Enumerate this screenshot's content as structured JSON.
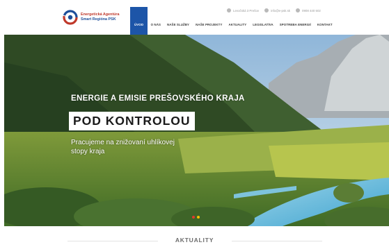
{
  "header": {
    "logo": {
      "line1": "Energetická Agentúra",
      "line2": "Smart Regióna PSK"
    },
    "topbar": [
      {
        "icon": "map-pin-icon",
        "text": "Levočská 3 Prešov"
      },
      {
        "icon": "mail-icon",
        "text": "info@e-psk.sk"
      },
      {
        "icon": "phone-icon",
        "text": "0908 440 502"
      }
    ],
    "nav": [
      {
        "label": "ÚVOD",
        "active": true
      },
      {
        "label": "O NÁS",
        "active": false
      },
      {
        "label": "NAŠE SLUŽBY",
        "active": false
      },
      {
        "label": "NAŠE PROJEKTY",
        "active": false
      },
      {
        "label": "AKTUALITY",
        "active": false
      },
      {
        "label": "LEGISLATÍVA",
        "active": false
      },
      {
        "label": "SPOTREBA ENERGIÍ",
        "active": false
      },
      {
        "label": "KONTAKT",
        "active": false
      }
    ]
  },
  "hero": {
    "headline": "ENERGIE A EMISIE PREŠOVSKÉHO KRAJA",
    "subhead": "POD KONTROLOU",
    "tagline": "Pracujeme na znižovaní uhlíkovej stopy kraja",
    "slider": {
      "count": 2,
      "active_index": 0
    }
  },
  "sections": {
    "news_title": "AKTUALITY"
  },
  "colors": {
    "brand_blue": "#1d55a8",
    "brand_red": "#c0392b",
    "dot_active": "#e03a2f",
    "dot_inactive": "#f2c200"
  }
}
